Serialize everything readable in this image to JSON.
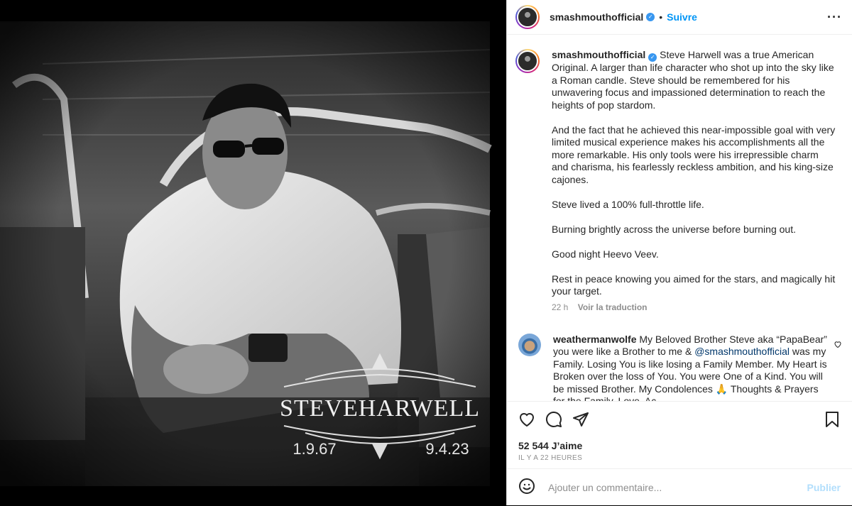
{
  "post": {
    "username": "smashmouthofficial",
    "dot": "•",
    "follow_label": "Suivre",
    "more_label": "···",
    "image": {
      "overlay_title": "STEVEHARWELL",
      "date_left": "1.9.67",
      "date_right": "9.4.23"
    },
    "caption_paragraphs": [
      "Steve Harwell was a true American Original. A larger than life character who shot up into the sky like a Roman candle. Steve should be remembered for his unwavering focus and impassioned determination to reach the heights of pop stardom.",
      "And the fact that he achieved this near-impossible goal with very limited musical experience makes his accomplishments all the more remarkable. His only tools were his irrepressible charm and charisma, his fearlessly reckless ambition, and his king-size cajones.",
      "Steve lived a 100% full-throttle life.",
      "Burning brightly across the universe before burning out.",
      "Good night Heevo Veev.",
      "Rest in peace knowing you aimed for the stars, and magically hit your target."
    ],
    "caption_time": "22 h",
    "translate_label": "Voir la traduction",
    "comment": {
      "username": "weathermanwolfe",
      "text_before": " My Beloved Brother Steve aka “PapaBear” you were like a Brother to me & ",
      "mention": "@smashmouthofficial",
      "text_after": " was my Family. Losing You is like losing a Family Member. My Heart is Broken over the loss of You. You were One of a Kind. You will be missed Brother. My Condolences 🙏 Thoughts & Prayers for the Family. Love, Ac",
      "like_icon": "heart-outline-icon"
    },
    "likes_text": "52 544 J’aime",
    "time_ago": "IL Y A 22 HEURES",
    "add_comment_placeholder": "Ajouter un commentaire...",
    "publish_label": "Publier"
  },
  "colors": {
    "accent": "#0095f6",
    "verified": "#3897f0",
    "muted": "#8e8e8e",
    "text": "#262626"
  }
}
